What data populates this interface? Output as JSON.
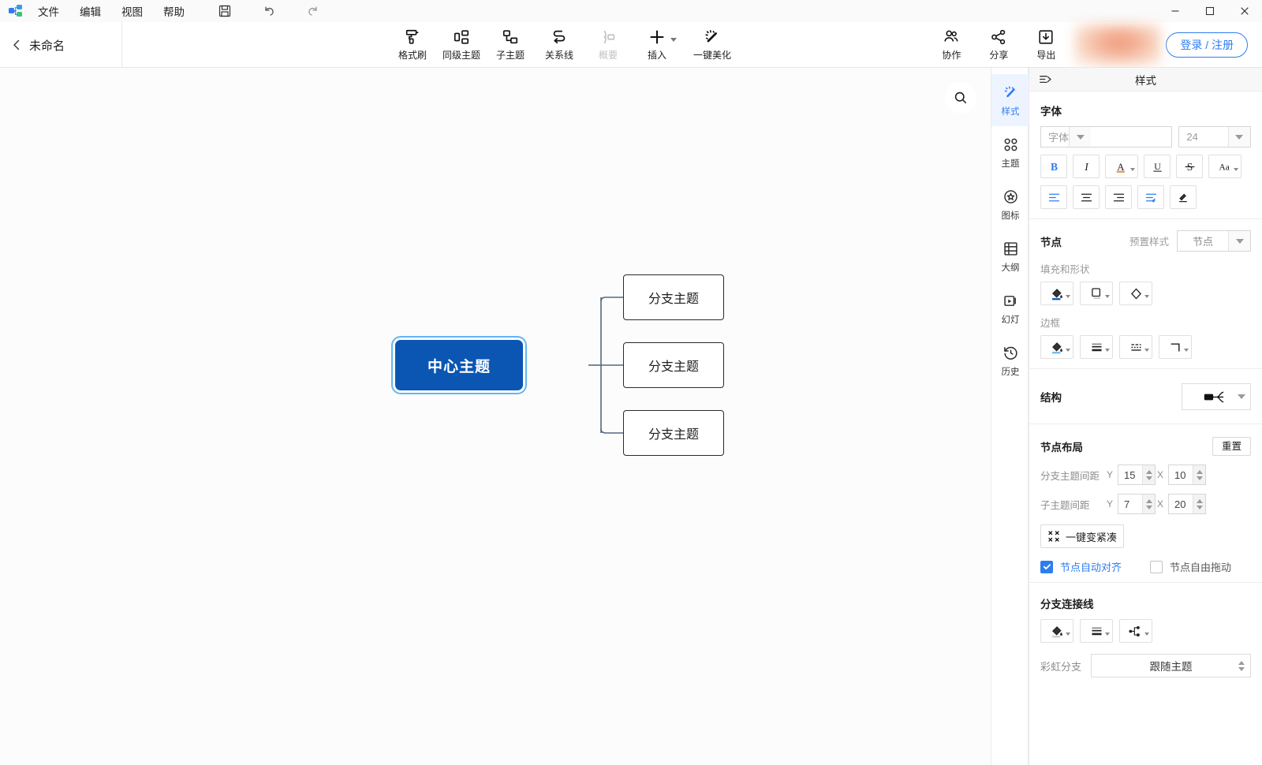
{
  "window": {
    "minimize": "—",
    "maximize": "☐",
    "close": "✕"
  },
  "menubar": {
    "logo": "app-logo",
    "items": [
      {
        "label": "文件",
        "name": "menu-file"
      },
      {
        "label": "编辑",
        "name": "menu-edit"
      },
      {
        "label": "视图",
        "name": "menu-view"
      },
      {
        "label": "帮助",
        "name": "menu-help"
      }
    ],
    "quick_actions": [
      {
        "name": "save-icon",
        "label": "保存"
      },
      {
        "name": "undo-icon",
        "label": "撤销"
      },
      {
        "name": "redo-icon",
        "label": "重做"
      }
    ]
  },
  "header": {
    "back": "back-icon",
    "doc_title": "未命名",
    "tools": [
      {
        "label": "格式刷",
        "name": "format-painter",
        "icon": "format-painter-icon",
        "disabled": false,
        "caret": false
      },
      {
        "label": "同级主题",
        "name": "sibling-topic",
        "icon": "sibling-topic-icon",
        "disabled": false,
        "caret": false
      },
      {
        "label": "子主题",
        "name": "sub-topic",
        "icon": "sub-topic-icon",
        "disabled": false,
        "caret": false
      },
      {
        "label": "关系线",
        "name": "relation-line",
        "icon": "relation-line-icon",
        "disabled": false,
        "caret": false
      },
      {
        "label": "概要",
        "name": "summary",
        "icon": "summary-icon",
        "disabled": true,
        "caret": false
      },
      {
        "label": "插入",
        "name": "insert",
        "icon": "plus-icon",
        "disabled": false,
        "caret": true
      },
      {
        "label": "一键美化",
        "name": "beautify",
        "icon": "magic-wand-icon",
        "disabled": false,
        "caret": false
      }
    ],
    "right_tools": [
      {
        "label": "协作",
        "name": "collaborate",
        "icon": "users-icon"
      },
      {
        "label": "分享",
        "name": "share",
        "icon": "share-icon"
      },
      {
        "label": "导出",
        "name": "export",
        "icon": "download-icon"
      }
    ],
    "login_label": "登录 / 注册"
  },
  "canvas": {
    "search_icon": "search-icon"
  },
  "mindmap": {
    "center": {
      "text": "中心主题",
      "fill": "#0b56b2",
      "text_color": "#ffffff",
      "selected": true
    },
    "branches": [
      {
        "text": "分支主题"
      },
      {
        "text": "分支主题"
      },
      {
        "text": "分支主题"
      }
    ],
    "line_color": "#56687f"
  },
  "rail": {
    "items": [
      {
        "label": "样式",
        "name": "tab-style",
        "icon": "style-wand-icon",
        "active": true
      },
      {
        "label": "主题",
        "name": "tab-theme",
        "icon": "theme-grid-icon",
        "active": false
      },
      {
        "label": "图标",
        "name": "tab-icon",
        "icon": "star-badge-icon",
        "active": false
      },
      {
        "label": "大纲",
        "name": "tab-outline",
        "icon": "outline-icon",
        "active": false
      },
      {
        "label": "幻灯",
        "name": "tab-slides",
        "icon": "slideshow-icon",
        "active": false
      },
      {
        "label": "历史",
        "name": "tab-history",
        "icon": "history-clock-icon",
        "active": false
      }
    ]
  },
  "panel": {
    "collapse_icon": "collapse-panel-icon",
    "title": "样式",
    "font_section": {
      "title": "字体",
      "font_family_placeholder": "字体",
      "font_size": "24",
      "format_buttons": [
        {
          "name": "bold-button",
          "glyph": "B"
        },
        {
          "name": "italic-button",
          "glyph": "I"
        },
        {
          "name": "font-color-button",
          "glyph": "A"
        },
        {
          "name": "underline-button",
          "glyph": "U"
        },
        {
          "name": "strikethrough-button",
          "glyph": "S"
        },
        {
          "name": "text-case-button",
          "glyph": "Aa"
        }
      ],
      "align_buttons": [
        {
          "name": "align-left-button"
        },
        {
          "name": "align-center-button"
        },
        {
          "name": "align-right-button"
        },
        {
          "name": "indent-button"
        },
        {
          "name": "clear-format-button"
        }
      ]
    },
    "node_section": {
      "title": "节点",
      "preset_label": "预置样式",
      "preset_value": "节点",
      "fill_shape_label": "填充和形状",
      "fill_shape_buttons": [
        {
          "name": "node-fill-color-button"
        },
        {
          "name": "node-shape-button"
        },
        {
          "name": "node-diamond-shape-button"
        }
      ],
      "border_label": "边框",
      "border_buttons": [
        {
          "name": "border-color-button"
        },
        {
          "name": "border-width-button"
        },
        {
          "name": "border-dash-button"
        },
        {
          "name": "border-corner-button"
        }
      ]
    },
    "structure_section": {
      "label": "结构",
      "value_icon": "structure-right-logic-icon"
    },
    "layout_section": {
      "title": "节点布局",
      "reset_label": "重置",
      "branch_spacing": {
        "label": "分支主题间距",
        "y_axis": "Y",
        "y": "15",
        "x_axis": "X",
        "x": "10"
      },
      "child_spacing": {
        "label": "子主题间距",
        "y_axis": "Y",
        "y": "7",
        "x_axis": "X",
        "x": "20"
      },
      "compact_label": "一键变紧凑",
      "compact_icon": "compact-icon",
      "auto_align": {
        "label": "节点自动对齐",
        "checked": true
      },
      "free_drag": {
        "label": "节点自由拖动",
        "checked": false
      }
    },
    "branch_line_section": {
      "title": "分支连接线",
      "buttons": [
        {
          "name": "branch-line-color-button"
        },
        {
          "name": "branch-line-width-button"
        },
        {
          "name": "branch-line-style-button"
        }
      ],
      "rainbow_label": "彩虹分支",
      "rainbow_value": "跟随主题"
    }
  },
  "colors": {
    "accent": "#2e7df0",
    "center_node": "#0b56b2",
    "selection_ring": "#63b6f2",
    "canvas_bg": "#fcfcfc"
  }
}
